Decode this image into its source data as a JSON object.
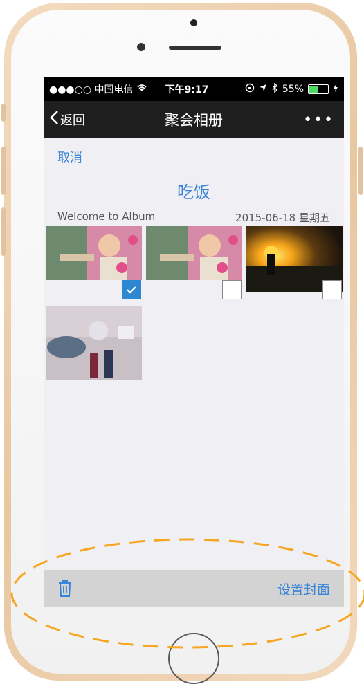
{
  "status_bar": {
    "carrier": "●●●○○ 中国电信",
    "time": "下午9:17",
    "battery_percent": "55%",
    "battery_level": 0.55
  },
  "nav": {
    "back_label": "返回",
    "title": "聚会相册",
    "more_label": "•••"
  },
  "cancel_label": "取消",
  "album_title": "吃饭",
  "album_subtitle": "Welcome to Album",
  "album_date": "2015-06-18 星期五",
  "photos": [
    {
      "name": "baby-feeding-1",
      "selected": true
    },
    {
      "name": "baby-feeding-2",
      "selected": false
    },
    {
      "name": "sunset-silhouette",
      "selected": false
    },
    {
      "name": "toy-figures",
      "selected": false
    }
  ],
  "toolbar": {
    "delete_icon": "trash-icon",
    "set_cover_label": "设置封面"
  },
  "colors": {
    "accent": "#3a84d6",
    "highlight_ellipse": "#f5a623"
  }
}
